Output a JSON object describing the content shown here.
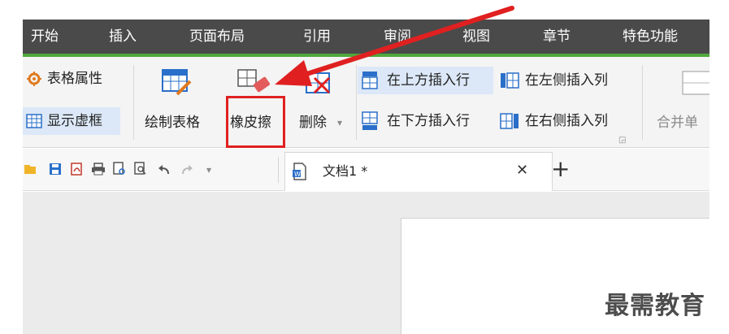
{
  "menu": {
    "items": [
      "开始",
      "插入",
      "页面布局",
      "引用",
      "审阅",
      "视图",
      "章节",
      "特色功能"
    ],
    "bar_color": "#4a4a4a",
    "accent_color": "#4fa83d"
  },
  "ribbon": {
    "table_properties": "表格属性",
    "show_gridlines": "显示虚框",
    "draw_table": "绘制表格",
    "eraser": "橡皮擦",
    "delete": "删除",
    "insert_row_above": "在上方插入行",
    "insert_row_below": "在下方插入行",
    "insert_col_left": "在左侧插入列",
    "insert_col_right": "在右侧插入列",
    "merge_cells": "合并单"
  },
  "tabbar": {
    "doc_tab_title": "文档1 *",
    "close_glyph": "✕",
    "new_tab_glyph": "+"
  },
  "annotation": {
    "highlight_color": "#e02020"
  },
  "watermark": "最需教育"
}
